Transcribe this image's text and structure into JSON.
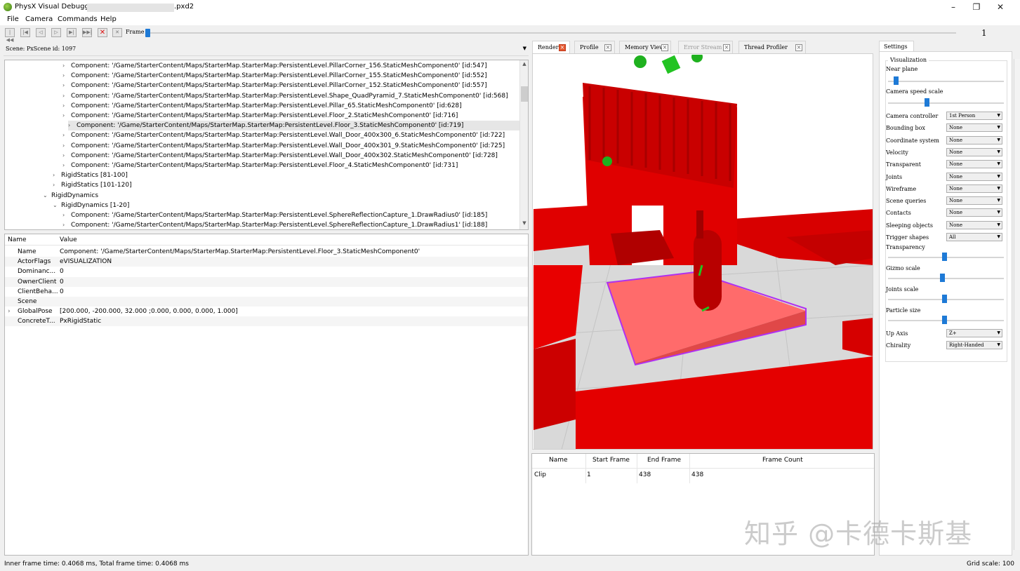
{
  "window": {
    "title_prefix": "PhysX Visual Debugger",
    "title_suffix": ".pxd2",
    "minimize": "–",
    "maximize": "❐",
    "close": "✕"
  },
  "menu": {
    "file": "File",
    "camera": "Camera",
    "commands": "Commands",
    "help": "Help"
  },
  "toolbar": {
    "frame_label": "Frame",
    "frame_number": "1",
    "frame_position": 0.0,
    "buttons": [
      "first-frame-icon",
      "prev-keyframe-icon",
      "prev-frame-icon",
      "play-icon",
      "next-frame-icon",
      "last-frame-icon",
      "stop-icon",
      "disconnect-icon"
    ]
  },
  "scene_select": {
    "value": "Scene: PxScene id: 1097"
  },
  "tree": {
    "rows": [
      {
        "indent": 3,
        "chev": "›",
        "text": "Component: '/Game/StarterContent/Maps/StarterMap.StarterMap:PersistentLevel.PillarCorner_156.StaticMeshComponent0'  [id:547]"
      },
      {
        "indent": 3,
        "chev": "›",
        "text": "Component: '/Game/StarterContent/Maps/StarterMap.StarterMap:PersistentLevel.PillarCorner_155.StaticMeshComponent0'  [id:552]"
      },
      {
        "indent": 3,
        "chev": "›",
        "text": "Component: '/Game/StarterContent/Maps/StarterMap.StarterMap:PersistentLevel.PillarCorner_152.StaticMeshComponent0'  [id:557]"
      },
      {
        "indent": 3,
        "chev": "›",
        "text": "Component: '/Game/StarterContent/Maps/StarterMap.StarterMap:PersistentLevel.Shape_QuadPyramid_7.StaticMeshComponent0'  [id:568]"
      },
      {
        "indent": 3,
        "chev": "›",
        "text": "Component: '/Game/StarterContent/Maps/StarterMap.StarterMap:PersistentLevel.Pillar_65.StaticMeshComponent0'  [id:628]"
      },
      {
        "indent": 3,
        "chev": "›",
        "text": "Component: '/Game/StarterContent/Maps/StarterMap.StarterMap:PersistentLevel.Floor_2.StaticMeshComponent0'  [id:716]"
      },
      {
        "indent": 3,
        "chev": "›",
        "text": "Component: '/Game/StarterContent/Maps/StarterMap.StarterMap:PersistentLevel.Floor_3.StaticMeshComponent0'  [id:719]",
        "selected": true
      },
      {
        "indent": 3,
        "chev": "›",
        "text": "Component: '/Game/StarterContent/Maps/StarterMap.StarterMap:PersistentLevel.Wall_Door_400x300_6.StaticMeshComponent0'  [id:722]"
      },
      {
        "indent": 3,
        "chev": "›",
        "text": "Component: '/Game/StarterContent/Maps/StarterMap.StarterMap:PersistentLevel.Wall_Door_400x301_9.StaticMeshComponent0'  [id:725]"
      },
      {
        "indent": 3,
        "chev": "›",
        "text": "Component: '/Game/StarterContent/Maps/StarterMap.StarterMap:PersistentLevel.Wall_Door_400x302.StaticMeshComponent0'  [id:728]"
      },
      {
        "indent": 3,
        "chev": "›",
        "text": "Component: '/Game/StarterContent/Maps/StarterMap.StarterMap:PersistentLevel.Floor_4.StaticMeshComponent0'  [id:731]"
      },
      {
        "indent": 2,
        "chev": "›",
        "text": "RigidStatics [81-100]"
      },
      {
        "indent": 2,
        "chev": "›",
        "text": "RigidStatics [101-120]"
      },
      {
        "indent": 1,
        "chev": "⌄",
        "text": "RigidDynamics"
      },
      {
        "indent": 2,
        "chev": "⌄",
        "text": "RigidDynamics [1-20]"
      },
      {
        "indent": 3,
        "chev": "›",
        "text": "Component: '/Game/StarterContent/Maps/StarterMap.StarterMap:PersistentLevel.SphereReflectionCapture_1.DrawRadius0'  [id:185]"
      },
      {
        "indent": 3,
        "chev": "›",
        "text": "Component: '/Game/StarterContent/Maps/StarterMap.StarterMap:PersistentLevel.SphereReflectionCapture_1.DrawRadius1'  [id:188]"
      }
    ]
  },
  "properties": {
    "header_name": "Name",
    "header_value": "Value",
    "rows": [
      {
        "name": "Name",
        "value": "Component: '/Game/StarterContent/Maps/StarterMap.StarterMap:PersistentLevel.Floor_3.StaticMeshComponent0'",
        "chev": ""
      },
      {
        "name": "ActorFlags",
        "value": "eVISUALIZATION",
        "chev": ""
      },
      {
        "name": "Dominanc...",
        "value": "0",
        "chev": ""
      },
      {
        "name": "OwnerClient",
        "value": "0",
        "chev": ""
      },
      {
        "name": "ClientBeha...",
        "value": "0",
        "chev": ""
      },
      {
        "name": "Scene",
        "value": "",
        "chev": ""
      },
      {
        "name": "GlobalPose",
        "value": "[200.000, -200.000, 32.000 ;0.000, 0.000, 0.000, 1.000]",
        "chev": "›"
      },
      {
        "name": "ConcreteT...",
        "value": "PxRigidStatic",
        "chev": ""
      }
    ]
  },
  "tabs": [
    {
      "label": "Render",
      "active": true
    },
    {
      "label": "Profile",
      "active": false
    },
    {
      "label": "Memory View",
      "active": false
    },
    {
      "label": "Error Stream",
      "active": false,
      "disabled": true
    },
    {
      "label": "Thread Profiler",
      "active": false
    }
  ],
  "clips": {
    "headers": [
      "Name",
      "Start Frame",
      "End Frame",
      "Frame Count"
    ],
    "row": [
      "Clip",
      "1",
      "438",
      "438"
    ]
  },
  "settings": {
    "tab_label": "Settings",
    "group_label": "Visualization",
    "near_plane_label": "Near plane",
    "near_plane_value": 0.05,
    "camera_speed_label": "Camera speed scale",
    "camera_speed_value": 0.33,
    "dropdowns": [
      {
        "label": "Camera controller",
        "value": "1st Person"
      },
      {
        "label": "Bounding box",
        "value": "None"
      },
      {
        "label": "Coordinate system",
        "value": "None"
      },
      {
        "label": "Velocity",
        "value": "None"
      },
      {
        "label": "Transparent",
        "value": "None"
      },
      {
        "label": "Joints",
        "value": "None"
      },
      {
        "label": "Wireframe",
        "value": "None"
      },
      {
        "label": "Scene queries",
        "value": "None"
      },
      {
        "label": "Contacts",
        "value": "None"
      },
      {
        "label": "Sleeping objects",
        "value": "None"
      },
      {
        "label": "Trigger shapes",
        "value": "All"
      }
    ],
    "transparency_label": "Transparency",
    "transparency_value": 0.49,
    "gizmo_label": "Gizmo scale",
    "gizmo_value": 0.47,
    "joints_scale_label": "Joints scale",
    "joints_scale_value": 0.49,
    "particle_label": "Particle size",
    "particle_value": 0.49,
    "up_axis_label": "Up Axis",
    "up_axis_value": "Z+",
    "chirality_label": "Chirality",
    "chirality_value": "Right-Handed"
  },
  "status": {
    "left": "Inner frame time: 0.4068 ms, Total frame time: 0.4068 ms",
    "right": "Grid scale: 100"
  },
  "watermark": "知乎 @卡德卡斯基",
  "colors": {
    "accent": "#1e7ad6",
    "scene_red": "#e60000",
    "floor_pink": "#ff6b6b",
    "selection_outline": "#b030f0",
    "sphere_green": "#22bb22"
  }
}
